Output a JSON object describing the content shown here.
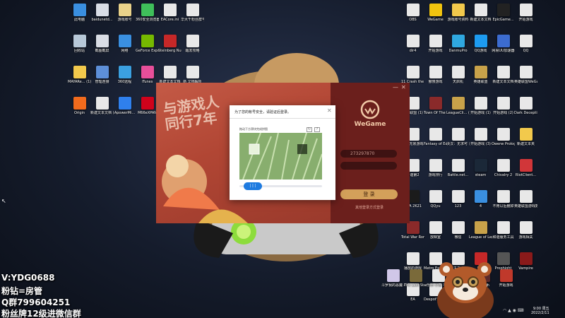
{
  "desktop_icons_left": [
    {
      "label": "此电脑",
      "color": "#3a8fe0",
      "icon": "computer-icon"
    },
    {
      "label": "baidunetd...",
      "color": "#d9dde5",
      "icon": "file-icon"
    },
    {
      "label": "游戏账号",
      "color": "#e9d28a",
      "icon": "file-icon"
    },
    {
      "label": "360安全浏览器",
      "color": "#3fbf5a",
      "icon": "browser-icon"
    },
    {
      "label": "EACore.ini",
      "color": "#e8e8e8",
      "icon": "file-icon"
    },
    {
      "label": "华大千粉丝群号",
      "color": "#e8e8e8",
      "icon": "file-icon"
    },
    {
      "label": "回收站",
      "color": "#b7c8d8",
      "icon": "recycle-bin-icon"
    },
    {
      "label": "截图截屏",
      "color": "#d9dde5",
      "icon": "file-icon"
    },
    {
      "label": "网络",
      "color": "#3a8fe0",
      "icon": "network-icon"
    },
    {
      "label": "GeForce Experience",
      "color": "#76b900",
      "icon": "nvidia-icon"
    },
    {
      "label": "Steinberg Nuendo 4",
      "color": "#c62828",
      "icon": "app-icon"
    },
    {
      "label": "醒发攻略",
      "color": "#e8e8e8",
      "icon": "file-icon"
    },
    {
      "label": "MAYARe... (1)",
      "color": "#f2c94c",
      "icon": "folder-icon"
    },
    {
      "label": "管理连接",
      "color": "#5d8fd8",
      "icon": "app-icon"
    },
    {
      "label": "360远程",
      "color": "#3ba0e0",
      "icon": "app-icon"
    },
    {
      "label": "iTunes",
      "color": "#e84f9a",
      "icon": "itunes-icon"
    },
    {
      "label": "新建文本文档",
      "color": "#e8e8e8",
      "icon": "file-icon"
    },
    {
      "label": "新 文档解析",
      "color": "#e8e8e8",
      "icon": "file-icon"
    },
    {
      "label": "Origin",
      "color": "#f26b1d",
      "icon": "origin-icon"
    },
    {
      "label": "新建文本文档 (5)",
      "color": "#e8e8e8",
      "icon": "file-icon"
    },
    {
      "label": "ApowerMi...",
      "color": "#2f80ed",
      "icon": "app-icon"
    },
    {
      "label": "M66eXPAN",
      "color": "#d0021b",
      "icon": "app-icon"
    }
  ],
  "desktop_icons_right": [
    {
      "label": "OBS",
      "color": "#e8e8e8",
      "icon": "file-icon"
    },
    {
      "label": "WeGame",
      "color": "#f1c40f",
      "icon": "wegame-icon"
    },
    {
      "label": "游戏账号资料",
      "color": "#f2c94c",
      "icon": "folder-icon"
    },
    {
      "label": "新建文本文档",
      "color": "#e8e8e8",
      "icon": "file-icon"
    },
    {
      "label": "EpicGame...",
      "color": "#222222",
      "icon": "epic-icon"
    },
    {
      "label": "开始游戏",
      "color": "#e8e8e8",
      "icon": "file-icon"
    },
    {
      "label": "dir4",
      "color": "#e8e8e8",
      "icon": "file-icon"
    },
    {
      "label": "开始游戏",
      "color": "#e8e8e8",
      "icon": "file-icon"
    },
    {
      "label": "DanmuPro",
      "color": "#2fa8e0",
      "icon": "app-icon"
    },
    {
      "label": "QQ游戏",
      "color": "#1d9bf0",
      "icon": "app-icon"
    },
    {
      "label": "网易UU加速器",
      "color": "#3c6cd0",
      "icon": "app-icon"
    },
    {
      "label": "QQ",
      "color": "#e8e8e8",
      "icon": "file-icon"
    },
    {
      "label": "11 Crash the Danc...",
      "color": "#e8e8e8",
      "icon": "file-icon"
    },
    {
      "label": "傲慢游戏",
      "color": "#e8e8e8",
      "icon": "file-icon"
    },
    {
      "label": "天启机",
      "color": "#e8e8e8",
      "icon": "file-icon"
    },
    {
      "label": "英雄联盟",
      "color": "#c8a24a",
      "icon": "lol-icon"
    },
    {
      "label": "新建文本文档",
      "color": "#e8e8e8",
      "icon": "file-icon"
    },
    {
      "label": "英雄联盟WeGame版",
      "color": "#e8e8e8",
      "icon": "file-icon"
    },
    {
      "label": "英雄联盟 (1)",
      "color": "#e8e8e8",
      "icon": "file-icon"
    },
    {
      "label": "Town Of The Dead ...",
      "color": "#8a2a2a",
      "icon": "app-icon"
    },
    {
      "label": "LeagueCli... (1)",
      "color": "#c8a24a",
      "icon": "lol-icon"
    },
    {
      "label": "开始游戏 (1)",
      "color": "#e8e8e8",
      "icon": "file-icon"
    },
    {
      "label": "开始游戏 (2)",
      "color": "#e8e8e8",
      "icon": "file-icon"
    },
    {
      "label": "Dark Deception",
      "color": "#e8e8e8",
      "icon": "file-icon"
    },
    {
      "label": "兆源无限游戏",
      "color": "#e8e8e8",
      "icon": "file-icon"
    },
    {
      "label": "Fantasy of Expedit...",
      "color": "#e8e8e8",
      "icon": "file-icon"
    },
    {
      "label": "决汉：无求可 问生存秘籍",
      "color": "#e8e8e8",
      "icon": "file-icon"
    },
    {
      "label": "开始游戏 (3)",
      "color": "#e8e8e8",
      "icon": "file-icon"
    },
    {
      "label": "Owerw Prologue",
      "color": "#e8e8e8",
      "icon": "file-icon"
    },
    {
      "label": "新建文本夹",
      "color": "#f2c94c",
      "icon": "folder-icon"
    },
    {
      "label": "和谐第2",
      "color": "#e8e8e8",
      "icon": "file-icon"
    },
    {
      "label": "游戏排行",
      "color": "#e8e8e8",
      "icon": "file-icon"
    },
    {
      "label": "Battle.net...",
      "color": "#e8e8e8",
      "icon": "file-icon"
    },
    {
      "label": "steam",
      "color": "#1b2838",
      "icon": "steam-icon"
    },
    {
      "label": "Chivalry 2",
      "color": "#e8e8e8",
      "icon": "file-icon"
    },
    {
      "label": "RiotClient...",
      "color": "#d13639",
      "icon": "riot-icon"
    },
    {
      "label": "NBA 2K21",
      "color": "#1b1b1b",
      "icon": "nba-icon"
    },
    {
      "label": "QQyu",
      "color": "#e8e8e8",
      "icon": "file-icon"
    },
    {
      "label": "123",
      "color": "#e8e8e8",
      "icon": "file-icon"
    },
    {
      "label": "4",
      "color": "#3a8fe0",
      "icon": "app-icon"
    },
    {
      "label": "不用以后删掉",
      "color": "#e8e8e8",
      "icon": "file-icon"
    },
    {
      "label": "英雄联盟游戏数据",
      "color": "#e8e8e8",
      "icon": "file-icon"
    },
    {
      "label": "Total War Rome 2 E...",
      "color": "#8a2a2a",
      "icon": "app-icon"
    },
    {
      "label": "放映室",
      "color": "#e8e8e8",
      "icon": "file-icon"
    },
    {
      "label": "微信",
      "color": "#e8e8e8",
      "icon": "file-icon"
    },
    {
      "label": "League of Legends...",
      "color": "#c8a24a",
      "icon": "lol-icon"
    },
    {
      "label": "和谐服务工具",
      "color": "#e8e8e8",
      "icon": "file-icon"
    },
    {
      "label": "游戏相关",
      "color": "#e8e8e8",
      "icon": "file-icon"
    },
    {
      "label": "播放的游戏",
      "color": "#e8e8e8",
      "icon": "file-icon"
    },
    {
      "label": "Metro Exodus",
      "color": "#e8e8e8",
      "icon": "file-icon"
    },
    {
      "label": "无主之地3",
      "color": "#e8e8e8",
      "icon": "file-icon"
    },
    {
      "label": "Sifu",
      "color": "#c62828",
      "icon": "app-icon"
    },
    {
      "label": "Prophight",
      "color": "#555555",
      "icon": "app-icon"
    },
    {
      "label": "Vampire",
      "color": "#8a1a1a",
      "icon": "app-icon"
    },
    {
      "label": "EA",
      "color": "#e8e8e8",
      "icon": "file-icon"
    },
    {
      "label": "Despot's Game D...",
      "color": "#e8e8e8",
      "icon": "file-icon"
    },
    {
      "label": "空名",
      "color": "#e8e8e8",
      "icon": "file-icon"
    },
    {
      "label": "开始游戏",
      "color": "#e8e8e8",
      "icon": "file-icon"
    }
  ],
  "desktop_icons_bottom": [
    {
      "label": "斗罗我的恶魔 Alina of...",
      "color": "#d0c7e8",
      "icon": "app-icon"
    },
    {
      "label": "The Last Stand A...",
      "color": "#7a6a3a",
      "icon": "app-icon"
    },
    {
      "label": "乐乐·小舞 不再",
      "color": "#e8e8e8",
      "icon": "file-icon"
    },
    {
      "label": "GW",
      "color": "#c62828",
      "icon": "app-icon"
    },
    {
      "label": "launch",
      "color": "#5a2a2a",
      "icon": "app-icon"
    },
    {
      "label": "开始游戏",
      "color": "#c0392b",
      "icon": "app-icon"
    }
  ],
  "wegame": {
    "slogan_line1": "与游戏人",
    "slogan_line2": "同行7年",
    "logo_text": "WeGame",
    "account": "273297870",
    "password_mask": "",
    "login_button": "登 录",
    "other_login": "其他登录方式登录",
    "brand_color": "#b14634"
  },
  "captcha": {
    "title": "为了您的帐号安全，请验证后登录。",
    "hint": "拖动下方滑块完成拼图",
    "slider_text": "| | |",
    "refresh_icon": "↻",
    "feedback_icon": "?",
    "accent": "#1e7be0"
  },
  "overlay": {
    "line1": "V:YDG0688",
    "line2": "粉钻=房管",
    "line3": "Q群799604251",
    "line4": "粉丝牌12级进微信群"
  },
  "taskbar": {
    "time": "9:00 周五",
    "date": "2022/2/11"
  }
}
